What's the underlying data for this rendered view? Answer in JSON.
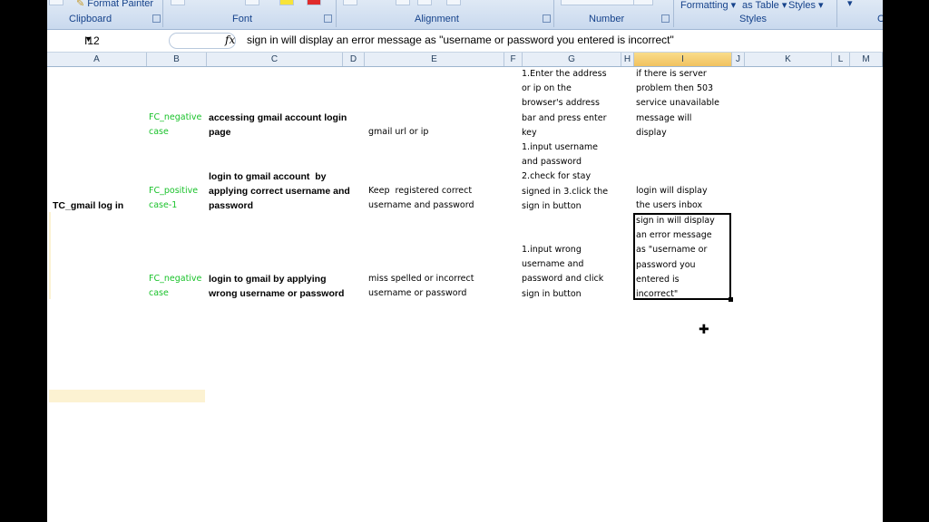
{
  "ribbon": {
    "clipboard_label": "Clipboard",
    "format_painter": "Format Painter",
    "font_label": "Font",
    "alignment_label": "Alignment",
    "number_label": "Number",
    "styles_label": "Styles",
    "conditional_formatting": "Formatting ▾",
    "format_as_table": "as Table ▾",
    "cell_styles": "Styles ▾",
    "cells_partial": "C"
  },
  "formula_bar": {
    "name_box": "I12",
    "fx": "fx",
    "content": "sign in will display an error message as \"username or password you entered is incorrect\""
  },
  "columns": [
    "A",
    "B",
    "C",
    "D",
    "E",
    "F",
    "G",
    "H",
    "I",
    "J",
    "K",
    "L",
    "M"
  ],
  "rows": [
    {
      "a": "",
      "b": "FC_negative\ncase",
      "c": "accessing gmail account login\npage",
      "e": "gmail url or ip",
      "g": "1.Enter the address\nor ip on the\nbrowser's address\nbar and press enter\nkey",
      "i": "if there is server\nproblem then 503\nservice unavailable\nmessage will\ndisplay"
    },
    {
      "a": "TC_gmail log in",
      "b": "FC_positive\ncase-1",
      "c": "login to gmail account  by\napplying correct username and\npassword",
      "e": "Keep  registered correct\nusername and password",
      "g": "1.input username\nand password\n2.check for stay\nsigned in 3.click the\nsign in button",
      "i": "login will display\nthe users inbox"
    },
    {
      "a": "",
      "b": "FC_negative\ncase",
      "c": "login to gmail by applying\nwrong username or password",
      "e": "miss spelled or incorrect\nusername or password",
      "g": "1.input wrong\nusername and\npassword and click\nsign in button",
      "i": "sign in will display\nan error message\nas \"username or\npassword you\nentered is\nincorrect\""
    }
  ]
}
